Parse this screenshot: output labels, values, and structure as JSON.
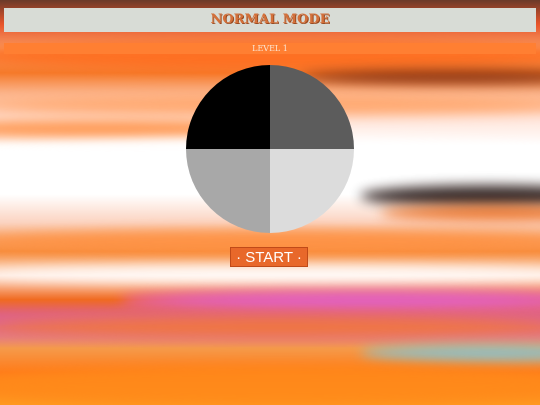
{
  "header": {
    "mode_title": "NORMAL MODE",
    "level_label": "LEVEL 1"
  },
  "wheel": {
    "quadrants": [
      {
        "position": "top-left",
        "color": "#000000"
      },
      {
        "position": "top-right",
        "color": "#5c5c5c"
      },
      {
        "position": "bottom-left",
        "color": "#a8a8a8"
      },
      {
        "position": "bottom-right",
        "color": "#dcdcdc"
      }
    ]
  },
  "controls": {
    "start_label": "· START ·"
  },
  "colors": {
    "accent": "#ff7f32",
    "title_text": "#d4703a",
    "banner_bg": "#d8dcd6"
  }
}
